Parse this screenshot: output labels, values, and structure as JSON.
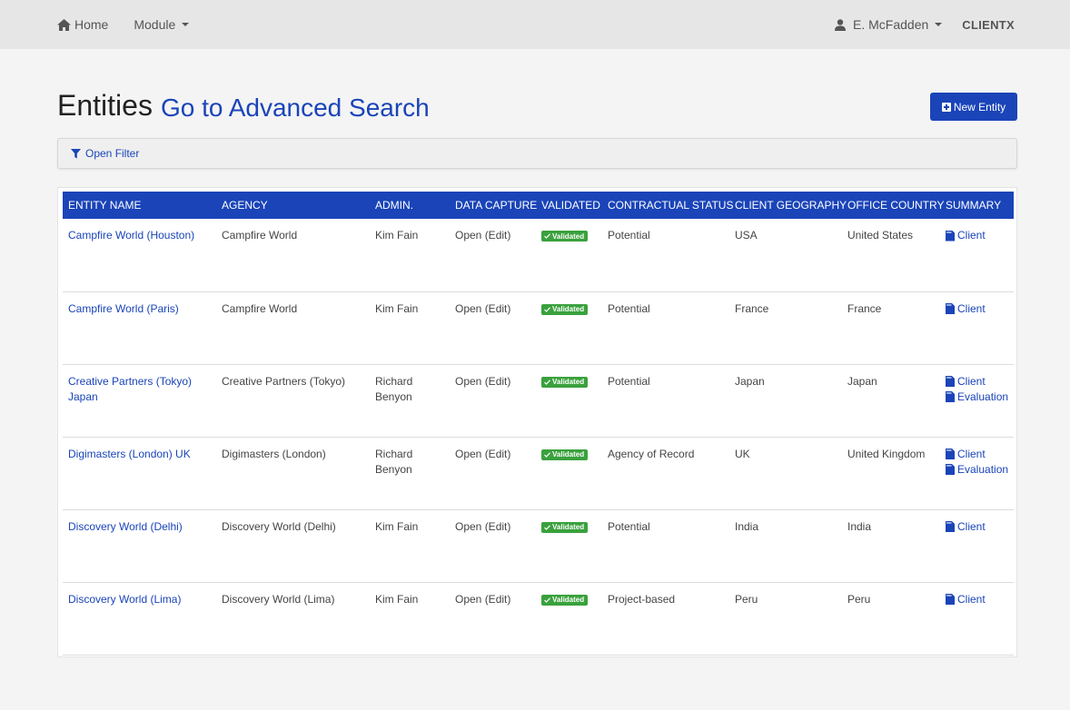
{
  "nav": {
    "home_label": "Home",
    "module_label": "Module",
    "user_label": "E. McFadden",
    "brand_label": "CLIENTX"
  },
  "header": {
    "title": "Entities",
    "advanced_search_label": "Go to Advanced Search",
    "new_entity_label": "New Entity"
  },
  "filter": {
    "label": "Open Filter"
  },
  "table": {
    "columns": [
      "ENTITY NAME",
      "AGENCY",
      "ADMIN.",
      "DATA CAPTURE",
      "VALIDATED",
      "CONTRACTUAL STATUS",
      "CLIENT GEOGRAPHY",
      "OFFICE COUNTRY",
      "SUMMARY"
    ],
    "rows": [
      {
        "entity": "Campfire World (Houston)",
        "agency": "Campfire World",
        "admin": "Kim Fain",
        "capture": "Open (Edit)",
        "validated": "Validated",
        "status": "Potential",
        "geography": "USA",
        "country": "United States",
        "summary": [
          "Client"
        ]
      },
      {
        "entity": "Campfire World (Paris)",
        "agency": "Campfire World",
        "admin": "Kim Fain",
        "capture": "Open (Edit)",
        "validated": "Validated",
        "status": "Potential",
        "geography": "France",
        "country": "France",
        "summary": [
          "Client"
        ]
      },
      {
        "entity": "Creative Partners (Tokyo) Japan",
        "agency": "Creative Partners (Tokyo)",
        "admin": "Richard Benyon",
        "capture": "Open (Edit)",
        "validated": "Validated",
        "status": "Potential",
        "geography": "Japan",
        "country": "Japan",
        "summary": [
          "Client",
          "Evaluation"
        ]
      },
      {
        "entity": "Digimasters (London) UK",
        "agency": "Digimasters (London)",
        "admin": "Richard Benyon",
        "capture": "Open (Edit)",
        "validated": "Validated",
        "status": "Agency of Record",
        "geography": "UK",
        "country": "United Kingdom",
        "summary": [
          "Client",
          "Evaluation"
        ]
      },
      {
        "entity": "Discovery World (Delhi)",
        "agency": "Discovery World (Delhi)",
        "admin": "Kim Fain",
        "capture": "Open (Edit)",
        "validated": "Validated",
        "status": "Potential",
        "geography": "India",
        "country": "India",
        "summary": [
          "Client"
        ]
      },
      {
        "entity": "Discovery World (Lima)",
        "agency": "Discovery World (Lima)",
        "admin": "Kim Fain",
        "capture": "Open (Edit)",
        "validated": "Validated",
        "status": "Project-based",
        "geography": "Peru",
        "country": "Peru",
        "summary": [
          "Client"
        ]
      }
    ]
  },
  "colors": {
    "primary": "#1a44b8",
    "validated": "#3aa13d",
    "navbar_bg": "#e6e6e6",
    "page_bg": "#f4f4f4"
  }
}
